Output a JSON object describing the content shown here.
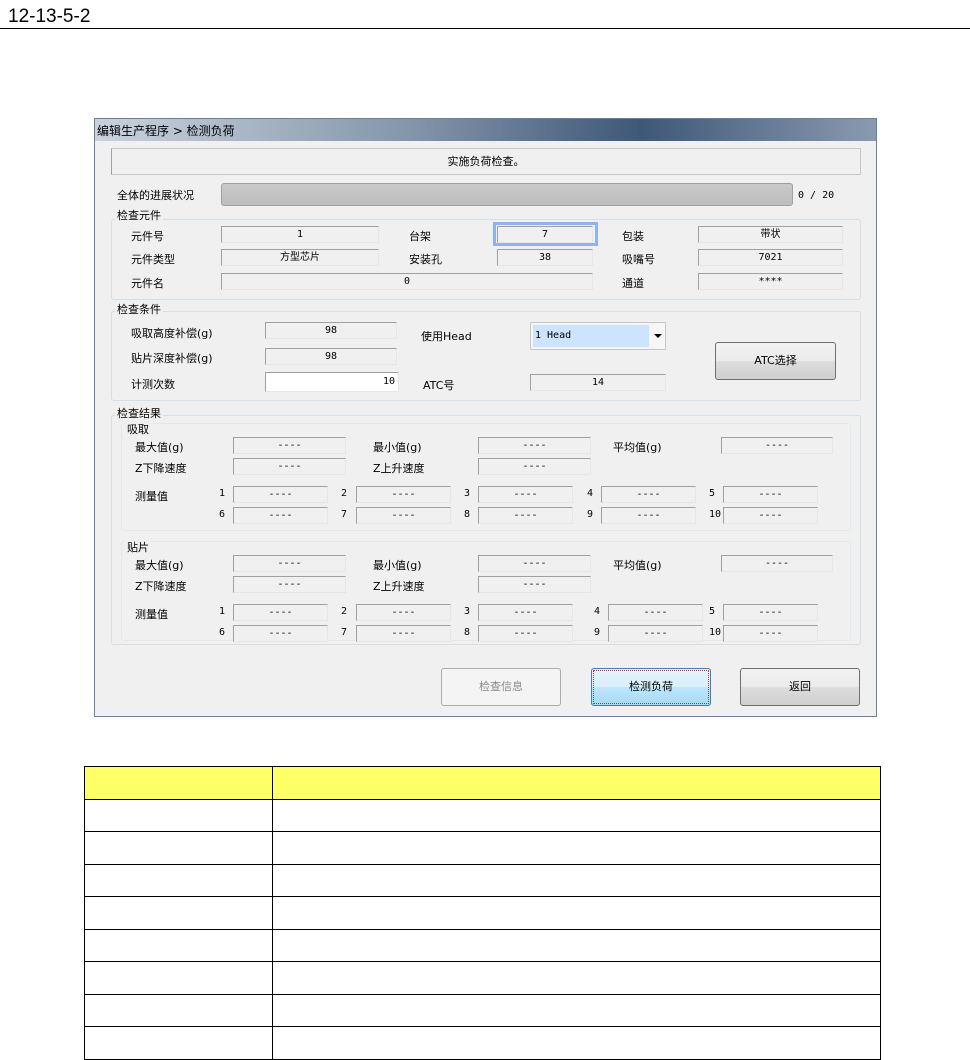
{
  "doc": {
    "ref": "12-13-5-2"
  },
  "window": {
    "title": "编辑生产程序 > 检测负荷"
  },
  "message": "实施负荷检查。",
  "progress": {
    "label": "全体的进展状况",
    "current": 0,
    "total": 20,
    "text": "0 / 20",
    "fraction": 0
  },
  "part": {
    "group_label": "检查元件",
    "part_no_label": "元件号",
    "part_no": "1",
    "rack_label": "台架",
    "rack": "7",
    "package_label": "包装",
    "package": "带状",
    "type_label": "元件类型",
    "type": "方型芯片",
    "hole_label": "安装孔",
    "hole": "38",
    "nozzle_label": "吸嘴号",
    "nozzle": "7021",
    "name_label": "元件名",
    "name": "0",
    "channel_label": "通道",
    "channel": "****"
  },
  "conditions": {
    "group_label": "检查条件",
    "pick_comp_label": "吸取高度补偿(g)",
    "pick_comp": "98",
    "place_comp_label": "贴片深度补偿(g)",
    "place_comp": "98",
    "count_label": "计测次数",
    "count": "10",
    "head_label": "使用Head",
    "head": "1 Head",
    "atc_label": "ATC号",
    "atc": "14",
    "atc_button": "ATC选择"
  },
  "results": {
    "group_label": "检查结果",
    "pick": {
      "label": "吸取",
      "max_label": "最大值(g)",
      "max": "----",
      "min_label": "最小值(g)",
      "min": "----",
      "avg_label": "平均值(g)",
      "avg": "----",
      "zdown_label": "Z下降速度",
      "zdown": "----",
      "zup_label": "Z上升速度",
      "zup": "----",
      "meas_label": "测量值",
      "meas": [
        "----",
        "----",
        "----",
        "----",
        "----",
        "----",
        "----",
        "----",
        "----",
        "----"
      ]
    },
    "place": {
      "label": "贴片",
      "max_label": "最大值(g)",
      "max": "----",
      "min_label": "最小值(g)",
      "min": "----",
      "avg_label": "平均值(g)",
      "avg": "----",
      "zdown_label": "Z下降速度",
      "zdown": "----",
      "zup_label": "Z上升速度",
      "zup": "----",
      "meas_label": "测量值",
      "meas": [
        "----",
        "----",
        "----",
        "----",
        "----",
        "----",
        "----",
        "----",
        "----",
        "----"
      ]
    },
    "indices": [
      "1",
      "2",
      "3",
      "4",
      "5",
      "6",
      "7",
      "8",
      "9",
      "10"
    ]
  },
  "buttons": {
    "info": "检查信息",
    "run": "检测负荷",
    "back": "返回"
  },
  "colors": {
    "table_header": "#ffff66",
    "focus": "#8fb3ee",
    "combo_selected": "#cce4ff"
  }
}
